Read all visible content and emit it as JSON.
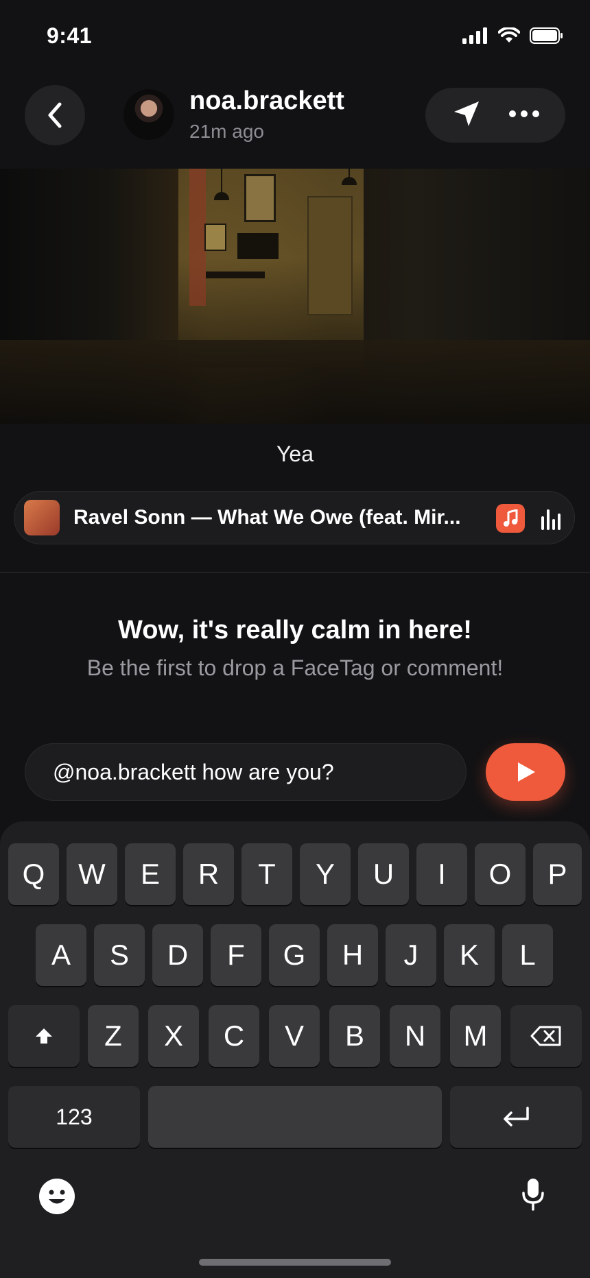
{
  "status_bar": {
    "time": "9:41"
  },
  "header": {
    "username": "noa.brackett",
    "time_ago": "21m ago"
  },
  "post": {
    "caption": "Yea",
    "music": {
      "track": "Ravel Sonn — What We Owe (feat. Mir..."
    }
  },
  "comments_empty": {
    "title": "Wow, it's really calm in here!",
    "subtitle": "Be the first to drop a FaceTag or comment!"
  },
  "composer": {
    "input_value": "@noa.brackett how are you?"
  },
  "keyboard": {
    "row1": [
      "Q",
      "W",
      "E",
      "R",
      "T",
      "Y",
      "U",
      "I",
      "O",
      "P"
    ],
    "row2": [
      "A",
      "S",
      "D",
      "F",
      "G",
      "H",
      "J",
      "K",
      "L"
    ],
    "row3": [
      "Z",
      "X",
      "C",
      "V",
      "B",
      "N",
      "M"
    ],
    "numbers_key": "123"
  },
  "colors": {
    "accent": "#ef5a3c",
    "background": "#121214",
    "surface": "#232326",
    "keyboard": "#1f1f22",
    "key": "#3a3a3d"
  },
  "icons": {
    "back": "chevron-left-icon",
    "send_direct": "paper-plane-icon",
    "more": "ellipsis-icon",
    "music_app": "music-note-icon",
    "now_playing": "equalizer-icon",
    "send_comment": "play-triangle-icon",
    "shift": "shift-arrow-icon",
    "delete": "backspace-icon",
    "return": "return-arrow-icon",
    "emoji": "emoji-face-icon",
    "dictation": "microphone-icon"
  }
}
